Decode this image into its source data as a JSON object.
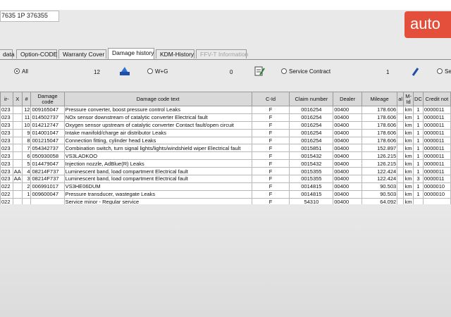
{
  "header": {
    "vin_fragment": "7635 1P 376355",
    "brand": "auto"
  },
  "tabs": [
    {
      "label": "data",
      "active": false,
      "disabled": false
    },
    {
      "label": "Option-CODE",
      "active": false,
      "disabled": false
    },
    {
      "label": "Warranty Cover",
      "active": false,
      "disabled": false
    },
    {
      "label": "Damage history",
      "active": true,
      "disabled": false
    },
    {
      "label": "KDM-History",
      "active": false,
      "disabled": false
    },
    {
      "label": "FFV-T Information",
      "active": false,
      "disabled": true
    }
  ],
  "filters": {
    "all_label": "All",
    "all_count": "12",
    "wg_label": "W+G",
    "wg_count": "0",
    "sc_label": "Service Contract",
    "sc_count": "1",
    "se_label": "Se"
  },
  "grid": {
    "columns": [
      "ir-",
      "X",
      "#",
      "Damage code",
      "Damage code text",
      "C-Id",
      "Claim number",
      "Dealer",
      "Mileage",
      "al",
      "M-Id",
      "DC",
      "Credit not"
    ],
    "rows": [
      [
        "023",
        "",
        "12",
        "009165047",
        "Pressure converter, boost pressure control Leaks",
        "F",
        "0016254",
        "00400",
        "178.606",
        "",
        "km",
        "1",
        "0000011"
      ],
      [
        "023",
        "",
        "11",
        "014502737",
        "NOx sensor downstream of catalytic converter Electrical fault",
        "F",
        "0016254",
        "00400",
        "178.606",
        "",
        "km",
        "1",
        "0000011"
      ],
      [
        "023",
        "",
        "10",
        "014212747",
        "Oxygen sensor upstream of catalytic converter Contact fault/open circuit",
        "F",
        "0016254",
        "00400",
        "178.606",
        "",
        "km",
        "1",
        "0000011"
      ],
      [
        "023",
        "",
        "9",
        "014001047",
        "Intake manifold/charge air distributor Leaks",
        "F",
        "0016254",
        "00400",
        "178.606",
        "",
        "km",
        "1",
        "0000011"
      ],
      [
        "023",
        "",
        "8",
        "001215047",
        "Connection fitting, cylinder head Leaks",
        "F",
        "0016254",
        "00400",
        "178.606",
        "",
        "km",
        "1",
        "0000011"
      ],
      [
        "023",
        "",
        "7",
        "054342737",
        "Combination switch, turn signal lights/lights/windshield wiper Electrical fault",
        "F",
        "0015851",
        "00400",
        "152.897",
        "",
        "km",
        "1",
        "0000011"
      ],
      [
        "023",
        "",
        "6",
        "050930058",
        "VS3LADKOO",
        "F",
        "0015432",
        "00400",
        "126.215",
        "",
        "km",
        "1",
        "0000011"
      ],
      [
        "023",
        "",
        "5",
        "014479047",
        "Injection nozzle, AdBlue(R) Leaks",
        "F",
        "0015432",
        "00400",
        "126.215",
        "",
        "km",
        "1",
        "0000011"
      ],
      [
        "023",
        "AA",
        "4",
        "08214F737",
        "Luminescent band, load compartment Electrical fault",
        "F",
        "0015355",
        "00400",
        "122.424",
        "",
        "km",
        "1",
        "0000011"
      ],
      [
        "023",
        "AA",
        "3",
        "08214F737",
        "Luminescent band, load compartment Electrical fault",
        "F",
        "0015355",
        "00400",
        "122.424",
        "",
        "km",
        "3",
        "0000011"
      ],
      [
        "022",
        "",
        "2",
        "006991017",
        "VS3HE06DUM",
        "F",
        "0014815",
        "00400",
        "90.503",
        "",
        "km",
        "1",
        "0000010"
      ],
      [
        "022",
        "",
        "1",
        "009600047",
        "Pressure transducer, wastegate Leaks",
        "F",
        "0014815",
        "00400",
        "90.503",
        "",
        "km",
        "1",
        "0000010"
      ],
      [
        "022",
        "",
        "",
        "",
        "Service minor - Regular service",
        "F",
        "54310",
        "00400",
        "64.092",
        "",
        "km",
        "",
        ""
      ]
    ]
  }
}
